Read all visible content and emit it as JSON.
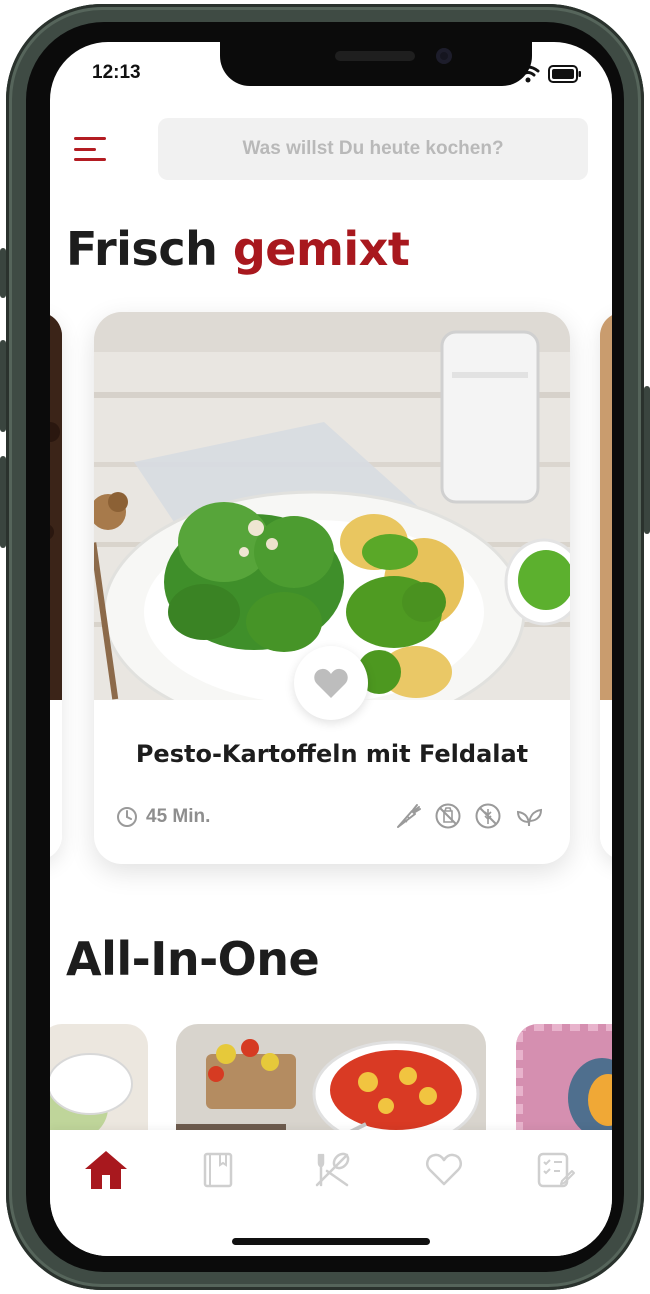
{
  "status_bar": {
    "time": "12:13"
  },
  "header": {
    "search_placeholder": "Was willst Du heute kochen?"
  },
  "section_fresh": {
    "title_main": "Frisch",
    "title_accent": "gemixt"
  },
  "featured_recipe": {
    "title": "Pesto-Kartoffeln mit Feldalat",
    "time": "45 Min.",
    "diet_icons": [
      "carrot-icon",
      "no-lactose-icon",
      "no-gluten-icon",
      "plant-icon"
    ]
  },
  "section_all_in_one": {
    "title": "All-In-One"
  },
  "bottom_nav": {
    "items": [
      "home-icon",
      "cookbook-icon",
      "cutlery-icon",
      "heart-icon",
      "shopping-list-icon"
    ],
    "active": "home-icon"
  },
  "colors": {
    "accent": "#a8181e",
    "muted": "#bdbdbd",
    "text": "#1d1d1d"
  }
}
